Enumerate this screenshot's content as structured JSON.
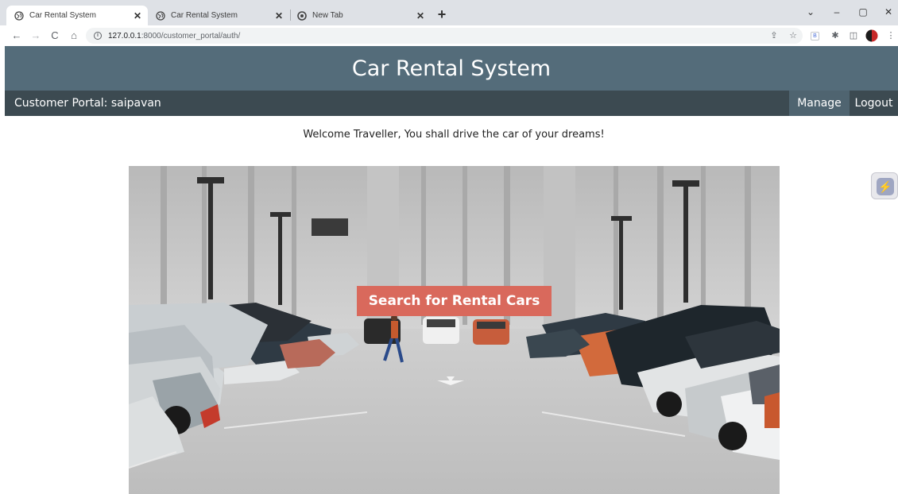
{
  "browser": {
    "tabs": [
      {
        "title": "Car Rental System",
        "active": true
      },
      {
        "title": "Car Rental System",
        "active": false
      },
      {
        "title": "New Tab",
        "active": false
      }
    ],
    "new_tab_label": "+",
    "url_host": "127.0.0.1",
    "url_rest": ":8000/customer_portal/auth/",
    "window_controls": {
      "chevron": "⌄",
      "minimize": "–",
      "restore": "▢",
      "close": "✕"
    },
    "nav_icons": {
      "back": "←",
      "forward": "→",
      "reload": "C",
      "home": "⌂"
    },
    "toolbar_icons": {
      "share": "⇪",
      "bookmark": "☆",
      "extension_badge": "B",
      "puzzle": "✱",
      "sidepanel": "◫",
      "menu": "⋮"
    }
  },
  "header": {
    "title": "Car Rental System"
  },
  "navbar": {
    "portal_label": "Customer Portal: saipavan",
    "manage": "Manage",
    "logout": "Logout"
  },
  "main": {
    "welcome": "Welcome Traveller, You shall drive the car of your dreams!",
    "search_button": "Search for Rental Cars"
  },
  "colors": {
    "header_bg": "#546c7a",
    "navbar_bg": "#3c4a51",
    "manage_bg": "#4f6470",
    "search_button_bg": "#d9695c"
  },
  "icons": {
    "ext_widget": "⚡"
  }
}
